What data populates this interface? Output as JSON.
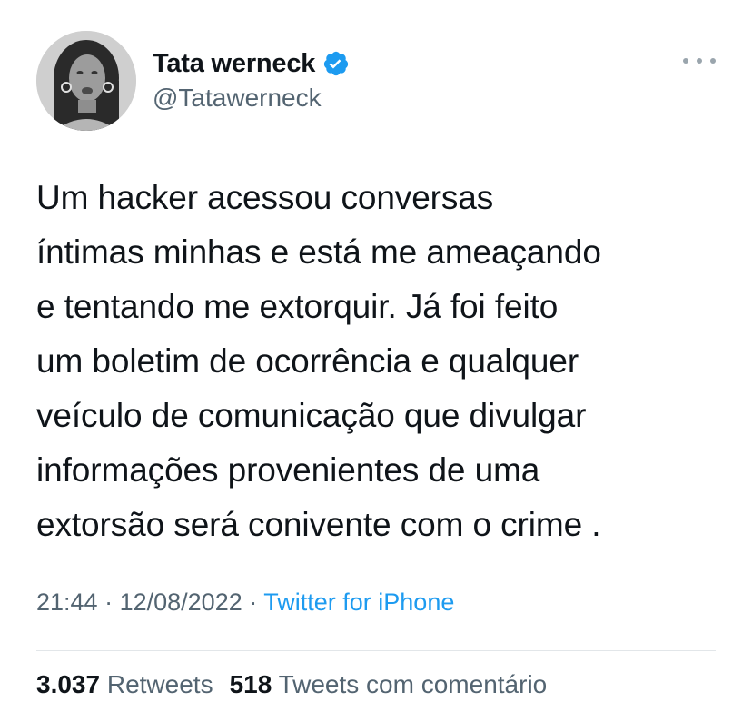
{
  "user": {
    "display_name": "Tata werneck",
    "handle": "@Tatawerneck",
    "verified_icon": "verified-badge-icon",
    "avatar_icon": "avatar-photo"
  },
  "tweet": {
    "text": "Um hacker acessou conversas\níntimas minhas e está me ameaçando\ne tentando me extorquir. Já foi feito\num boletim de ocorrência e qualquer\nveículo de comunicação que divulgar\ninformações provenientes de uma\nextorsão será conivente com o crime .",
    "time": "21:44",
    "date": "12/08/2022",
    "separator": "·",
    "source": "Twitter for iPhone"
  },
  "stats": {
    "retweets_count": "3.037",
    "retweets_label": "Retweets",
    "quotes_count": "518",
    "quotes_label": "Tweets com comentário"
  },
  "colors": {
    "link": "#1d9bf0",
    "secondary_text": "#536471",
    "primary_text": "#0f1419",
    "verified": "#1d9bf0"
  }
}
